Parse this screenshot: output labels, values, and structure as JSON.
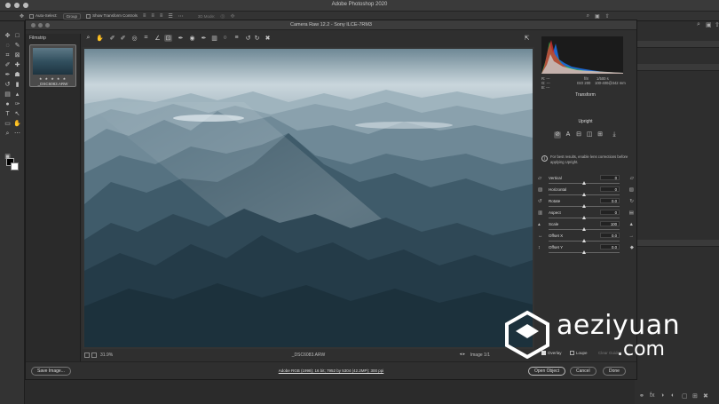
{
  "app_title": "Adobe Photoshop 2020",
  "options_bar": {
    "auto_select_label": "Auto-Select:",
    "auto_select_value": "Group",
    "transform_controls_label": "Show Transform Controls",
    "mode_3d_label": "3D Mode:"
  },
  "dialog": {
    "title": "Camera Raw 12.2  -  Sony ILCE-7RM3",
    "filmstrip_title": "Filmstrip",
    "thumb_name": "_DSC6083.ARW",
    "thumb_stars": "★ ★ ★ ★ ★",
    "zoom": "31.9%",
    "filename": "_DSC6083.ARW",
    "image_count": "Image 1/1"
  },
  "readout": {
    "r_label": "R:",
    "g_label": "G:",
    "b_label": "B:",
    "r": "---",
    "g": "---",
    "b": "---",
    "aperture": "f/8",
    "shutter": "1/500 s",
    "iso": "ISO 200",
    "lens": "100-400@342 mm"
  },
  "panel": {
    "section_title": "Transform",
    "upright_title": "Upright",
    "info_text": "For best results, enable lens corrections before applying Upright.",
    "sliders": [
      {
        "label": "Vertical",
        "value": "0",
        "position": 0.5
      },
      {
        "label": "Horizontal",
        "value": "0",
        "position": 0.5
      },
      {
        "label": "Rotate",
        "value": "0.0",
        "position": 0.5
      },
      {
        "label": "Aspect",
        "value": "0",
        "position": 0.5
      },
      {
        "label": "Scale",
        "value": "100",
        "position": 0.5
      },
      {
        "label": "Offset X",
        "value": "0.0",
        "position": 0.5
      },
      {
        "label": "Offset Y",
        "value": "0.0",
        "position": 0.5
      }
    ],
    "overlay_label": "Overlay",
    "loupe_label": "Loupe",
    "clear_guides_label": "Clear Guides"
  },
  "bottom": {
    "save_label": "Save Image...",
    "workflow_text": "Adobe RGB (1998); 16 bit; 7952 by 5304 (42.2MP); 300 ppi",
    "open_label": "Open Object",
    "cancel_label": "Cancel",
    "done_label": "Done"
  },
  "watermark": {
    "line1": "aeziyuan",
    "line2": ".com"
  },
  "colors": {
    "accent": "#4a90e2",
    "sky": "#b9cbd3",
    "mountain_dark": "#1a2e38"
  }
}
